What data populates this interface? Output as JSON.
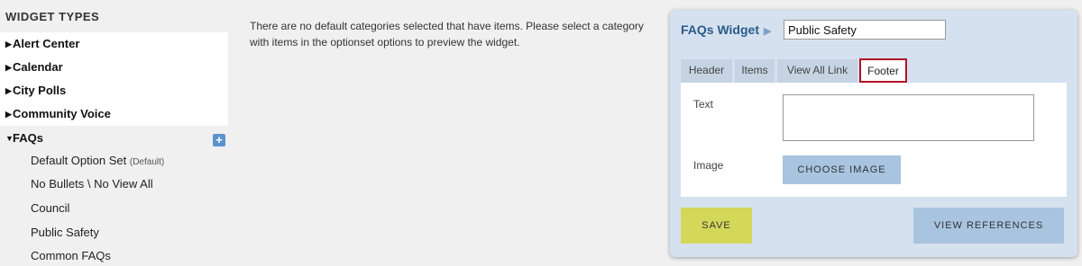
{
  "sidebar": {
    "title": "WIDGET TYPES",
    "items": [
      {
        "label": "Alert Center",
        "expanded": false
      },
      {
        "label": "Calendar",
        "expanded": false
      },
      {
        "label": "City Polls",
        "expanded": false
      },
      {
        "label": "Community Voice",
        "expanded": false
      },
      {
        "label": "FAQs",
        "expanded": true
      }
    ],
    "faq_options": [
      {
        "label": "Default Option Set",
        "tag": "(Default)"
      },
      {
        "label": "No Bullets \\ No View All",
        "tag": ""
      },
      {
        "label": "Council",
        "tag": ""
      },
      {
        "label": "Public Safety",
        "tag": ""
      },
      {
        "label": "Common FAQs",
        "tag": ""
      }
    ],
    "add_glyph": "+"
  },
  "main": {
    "message": "There are no default categories selected that have items. Please select a category with items in the optionset options to preview the widget."
  },
  "panel": {
    "breadcrumb": "FAQs Widget",
    "option_set_name": "Public Safety",
    "tabs": [
      {
        "label": "Header",
        "active": false
      },
      {
        "label": "Items",
        "active": false
      },
      {
        "label": "View All Link",
        "active": false
      },
      {
        "label": "Footer",
        "active": true
      }
    ],
    "fields": {
      "text_label": "Text",
      "text_value": "",
      "image_label": "Image",
      "choose_image": "CHOOSE IMAGE"
    },
    "save": "SAVE",
    "view_references": "VIEW REFERENCES"
  },
  "colors": {
    "accent": "#2b5b8a",
    "panel_bg": "#d5e1ef",
    "active_tab_border": "#b5102a",
    "save_button": "#d4d858",
    "secondary_button": "#a8c4e0",
    "add_icon": "#5b93cf"
  }
}
